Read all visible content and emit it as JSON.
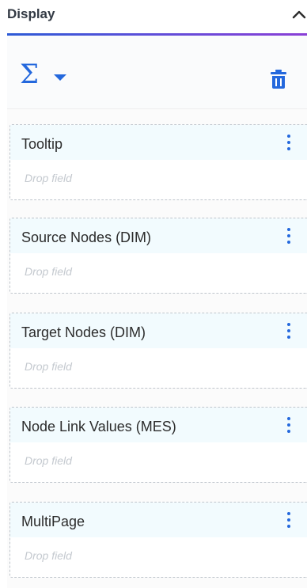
{
  "header": {
    "title": "Display",
    "colors": {
      "accent_start": "#2d5bd6",
      "accent_end": "#8a3fd6"
    }
  },
  "toolbar": {
    "aggregate_icon": "sigma-icon",
    "dropdown_icon": "caret-down-icon",
    "delete_icon": "trash-icon",
    "icon_color": "#2468dd"
  },
  "fields": [
    {
      "label": "Tooltip",
      "drop_placeholder": "Drop field"
    },
    {
      "label": "Source Nodes (DIM)",
      "drop_placeholder": "Drop field"
    },
    {
      "label": "Target Nodes (DIM)",
      "drop_placeholder": "Drop field"
    },
    {
      "label": "Node Link Values (MES)",
      "drop_placeholder": "Drop field"
    },
    {
      "label": "MultiPage",
      "drop_placeholder": "Drop field"
    }
  ]
}
